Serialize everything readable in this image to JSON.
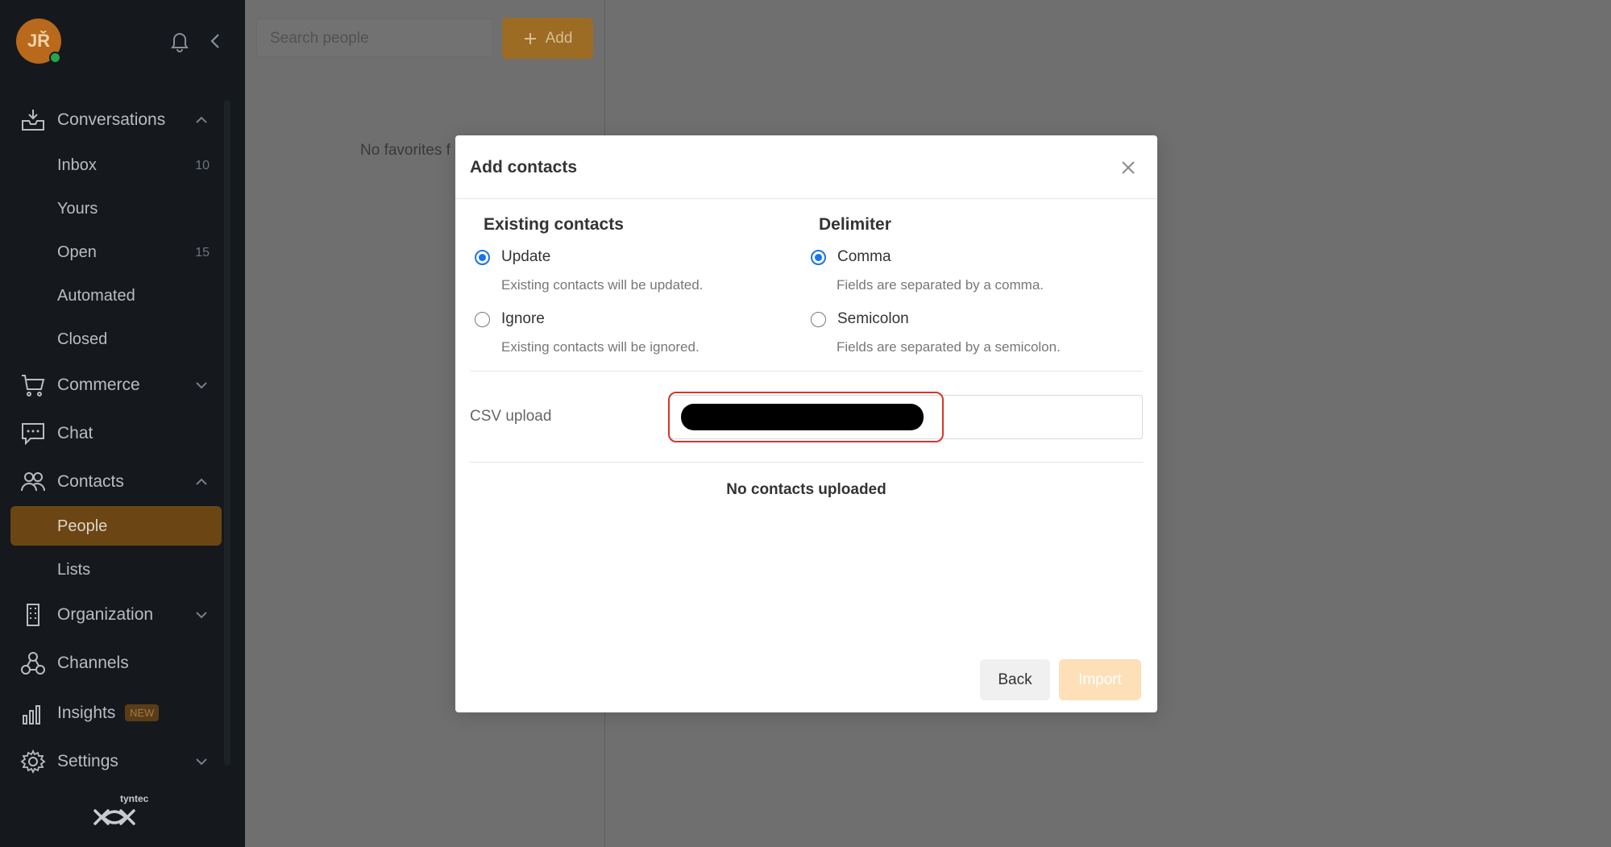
{
  "sidebar": {
    "avatar_initials": "JŘ",
    "nav": {
      "conversations": "Conversations",
      "commerce": "Commerce",
      "chat": "Chat",
      "contacts": "Contacts",
      "organization": "Organization",
      "channels": "Channels",
      "insights": "Insights",
      "insights_badge": "NEW",
      "settings": "Settings"
    },
    "conversation_items": [
      {
        "label": "Inbox",
        "count": "10"
      },
      {
        "label": "Yours",
        "count": ""
      },
      {
        "label": "Open",
        "count": "15"
      },
      {
        "label": "Automated",
        "count": ""
      },
      {
        "label": "Closed",
        "count": ""
      }
    ],
    "contact_items": [
      {
        "label": "People"
      },
      {
        "label": "Lists"
      }
    ],
    "logo_text": "tyntec"
  },
  "people_panel": {
    "search_placeholder": "Search people",
    "add_label": "Add",
    "empty_text": "No favorites f"
  },
  "modal": {
    "title": "Add contacts",
    "existing": {
      "heading": "Existing contacts",
      "options": [
        {
          "label": "Update",
          "description": "Existing contacts will be updated.",
          "selected": true
        },
        {
          "label": "Ignore",
          "description": "Existing contacts will be ignored.",
          "selected": false
        }
      ]
    },
    "delimiter": {
      "heading": "Delimiter",
      "options": [
        {
          "label": "Comma",
          "description": "Fields are separated by a comma.",
          "selected": true
        },
        {
          "label": "Semicolon",
          "description": "Fields are separated by a semicolon.",
          "selected": false
        }
      ]
    },
    "csv_label": "CSV upload",
    "empty_state": "No contacts uploaded",
    "back_label": "Back",
    "import_label": "Import"
  },
  "colors": {
    "accent": "#b8691b",
    "radio_selected": "#1a73e8",
    "highlight": "#d9352b"
  }
}
